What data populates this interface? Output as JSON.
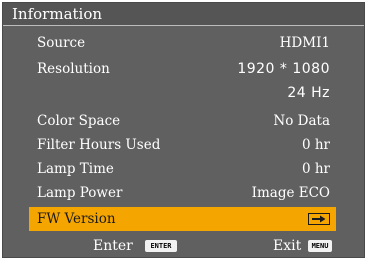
{
  "title": "Information",
  "rows": [
    {
      "label": "Source",
      "value": "HDMI1"
    },
    {
      "label": "Resolution",
      "value": "1920 * 1080"
    },
    {
      "label": "",
      "value": "24 Hz"
    },
    {
      "label": "Color Space",
      "value": "No Data"
    },
    {
      "label": "Filter Hours Used",
      "value": "0 hr"
    },
    {
      "label": "Lamp Time",
      "value": "0 hr"
    },
    {
      "label": "Lamp Power",
      "value": "Image ECO"
    },
    {
      "label": "FW Version",
      "value": ""
    }
  ],
  "selected_row": "FW Version",
  "footer": {
    "enter_label": "Enter",
    "enter_key": "ENTER",
    "exit_label": "Exit",
    "exit_key": "MENU"
  },
  "icons": {
    "fw_version": "submenu-arrow-icon"
  },
  "colors": {
    "panel": "#606060",
    "title_bar": "#555555",
    "highlight": "#f5a500",
    "text": "#ffffff"
  }
}
